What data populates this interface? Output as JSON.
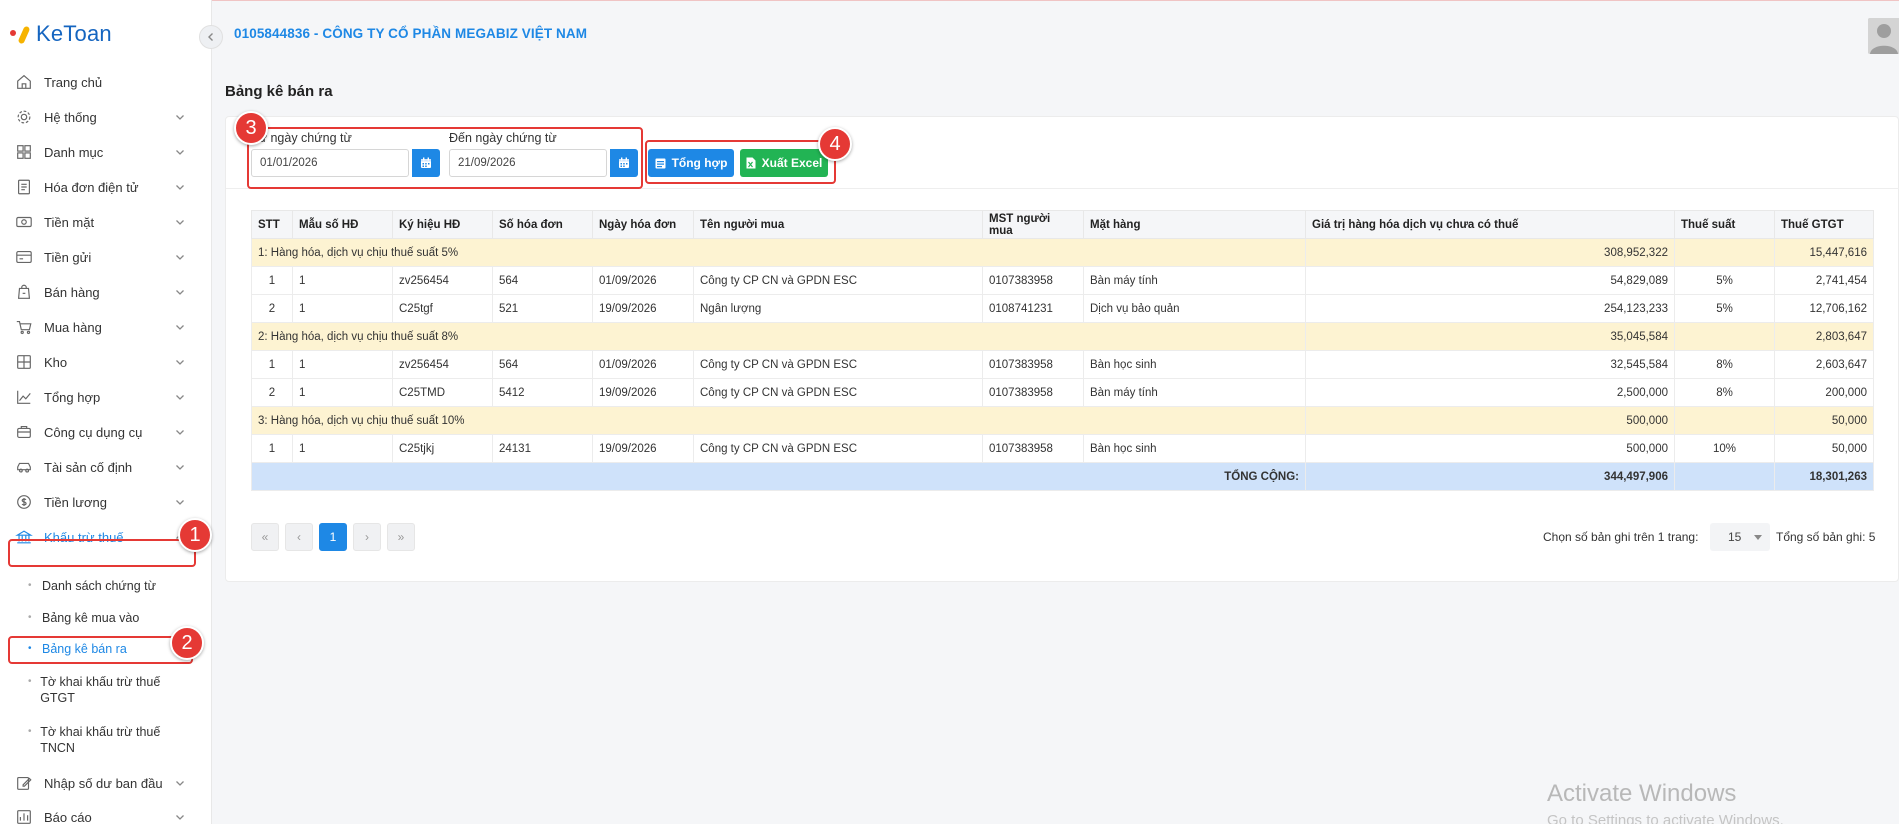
{
  "brand": {
    "name": "KeToan"
  },
  "header": {
    "company": "0105844836 - CÔNG TY CỔ PHẦN MEGABIZ VIỆT NAM"
  },
  "page": {
    "title": "Bảng kê bán ra"
  },
  "sidebar": {
    "items": [
      {
        "label": "Trang chủ",
        "icon": "home-icon"
      },
      {
        "label": "Hệ thống",
        "icon": "gear-icon"
      },
      {
        "label": "Danh mục",
        "icon": "grid-icon"
      },
      {
        "label": "Hóa đơn điện tử",
        "icon": "invoice-icon"
      },
      {
        "label": "Tiền mặt",
        "icon": "cash-icon"
      },
      {
        "label": "Tiền gửi",
        "icon": "bank-card-icon"
      },
      {
        "label": "Bán hàng",
        "icon": "sale-bag-icon"
      },
      {
        "label": "Mua hàng",
        "icon": "cart-icon"
      },
      {
        "label": "Kho",
        "icon": "warehouse-icon"
      },
      {
        "label": "Tổng hợp",
        "icon": "line-chart-icon"
      },
      {
        "label": "Công cụ dụng cụ",
        "icon": "tools-icon"
      },
      {
        "label": "Tài sản cố định",
        "icon": "car-icon"
      },
      {
        "label": "Tiền lương",
        "icon": "dollar-icon"
      },
      {
        "label": "Khấu trừ thuế",
        "icon": "bank-icon"
      }
    ],
    "subitems": [
      {
        "label": "Danh sách chứng từ"
      },
      {
        "label": "Bảng kê mua vào"
      },
      {
        "label": "Bảng kê bán ra"
      },
      {
        "label": "Tờ khai khấu trừ thuế GTGT"
      },
      {
        "label": "Tờ khai khấu trừ thuế TNCN"
      }
    ],
    "after": [
      {
        "label": "Nhập số dư ban đầu",
        "icon": "edit-icon"
      },
      {
        "label": "Báo cáo",
        "icon": "report-icon"
      }
    ]
  },
  "filter": {
    "from_label": "Từ ngày chứng từ",
    "from_value": "01/01/2026",
    "to_label": "Đến ngày chứng từ",
    "to_value": "21/09/2026",
    "summary_button": "Tổng hợp",
    "export_button": "Xuất Excel"
  },
  "table": {
    "headers": [
      "STT",
      "Mẫu số HĐ",
      "Ký hiệu HĐ",
      "Số hóa đơn",
      "Ngày hóa đơn",
      "Tên người mua",
      "MST người mua",
      "Mặt hàng",
      "Giá trị hàng hóa dịch vụ chưa có thuế",
      "Thuế suất",
      "Thuế GTGT"
    ],
    "groups": [
      {
        "title": "1: Hàng hóa, dịch vụ chịu thuế suất 5%",
        "subtotal_value": "308,952,322",
        "subtotal_tax": "15,447,616",
        "rows": [
          [
            "1",
            "1",
            "zv256454",
            "564",
            "01/09/2026",
            "Công ty CP CN và GPDN ESC",
            "0107383958",
            "Bàn máy tính",
            "54,829,089",
            "5%",
            "2,741,454"
          ],
          [
            "2",
            "1",
            "C25tgf",
            "521",
            "19/09/2026",
            "Ngân lượng",
            "0108741231",
            "Dịch vụ bảo quản",
            "254,123,233",
            "5%",
            "12,706,162"
          ]
        ]
      },
      {
        "title": "2: Hàng hóa, dịch vụ chịu thuế suất 8%",
        "subtotal_value": "35,045,584",
        "subtotal_tax": "2,803,647",
        "rows": [
          [
            "1",
            "1",
            "zv256454",
            "564",
            "01/09/2026",
            "Công ty CP CN và GPDN ESC",
            "0107383958",
            "Bàn học sinh",
            "32,545,584",
            "8%",
            "2,603,647"
          ],
          [
            "2",
            "1",
            "C25TMD",
            "5412",
            "19/09/2026",
            "Công ty CP CN và GPDN ESC",
            "0107383958",
            "Bàn máy tính",
            "2,500,000",
            "8%",
            "200,000"
          ]
        ]
      },
      {
        "title": "3: Hàng hóa, dịch vụ chịu thuế suất 10%",
        "subtotal_value": "500,000",
        "subtotal_tax": "50,000",
        "rows": [
          [
            "1",
            "1",
            "C25tjkj",
            "24131",
            "19/09/2026",
            "Công ty CP CN và GPDN ESC",
            "0107383958",
            "Bàn học sinh",
            "500,000",
            "10%",
            "50,000"
          ]
        ]
      }
    ],
    "total_label": "TỔNG CỘNG:",
    "total_value": "344,497,906",
    "total_tax": "18,301,263"
  },
  "pagination": {
    "current": "1",
    "per_page_label": "Chọn số bản ghi trên 1 trang:",
    "per_page": "15",
    "total_label": "Tổng số bản ghi:",
    "total": "5"
  },
  "annotations": [
    "1",
    "2",
    "3",
    "4"
  ],
  "watermark": {
    "line1": "Activate Windows",
    "line2": "Go to Settings to activate Windows."
  },
  "colors": {
    "accent": "#1e88e5",
    "export": "#22b454",
    "annotation": "#e53935",
    "group_row": "#fdf3d2",
    "total_row": "#cfe2fa"
  }
}
